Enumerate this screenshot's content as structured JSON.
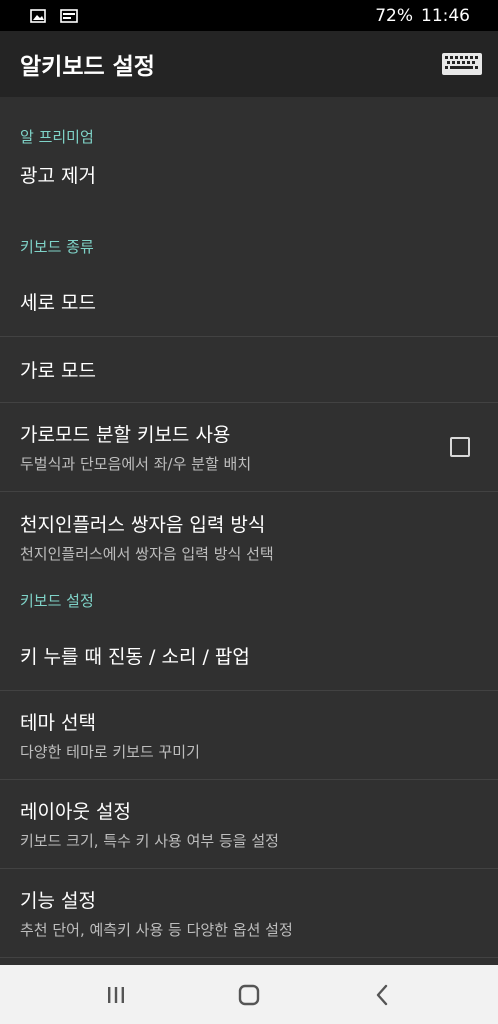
{
  "status": {
    "battery": "72%",
    "time": "11:46"
  },
  "app": {
    "title": "알키보드 설정"
  },
  "sections": {
    "premium": {
      "header": "알 프리미엄",
      "remove_ads": "광고 제거"
    },
    "keyboard_type": {
      "header": "키보드 종류",
      "portrait_mode": "세로 모드",
      "landscape_mode": "가로 모드",
      "split_keyboard": {
        "title": "가로모드 분할 키보드 사용",
        "subtitle": "두벌식과 단모음에서 좌/우 분할 배치",
        "checked": false
      },
      "cheonjiin": {
        "title": "천지인플러스 쌍자음 입력 방식",
        "subtitle": "천지인플러스에서 쌍자음 입력 방식 선택"
      }
    },
    "keyboard_settings": {
      "header": "키보드 설정",
      "key_feedback": "키 누를 때 진동 / 소리 / 팝업",
      "theme": {
        "title": "테마 선택",
        "subtitle": "다양한 테마로 키보드 꾸미기"
      },
      "layout": {
        "title": "레이아웃 설정",
        "subtitle": "키보드 크기, 특수 키 사용 여부 등을 설정"
      },
      "features": {
        "title": "기능 설정",
        "subtitle": "추천 단어, 예측키 사용 등 다양한 옵션 설정"
      }
    }
  },
  "colors": {
    "accent": "#7fd3c8",
    "background": "#303030",
    "app_bar": "#242424",
    "divider": "#424242"
  },
  "icons": {
    "status_left": [
      "gallery-icon",
      "message-icon"
    ],
    "app_bar": "keyboard-icon",
    "nav": [
      "recent-apps-icon",
      "home-icon",
      "back-icon"
    ]
  }
}
